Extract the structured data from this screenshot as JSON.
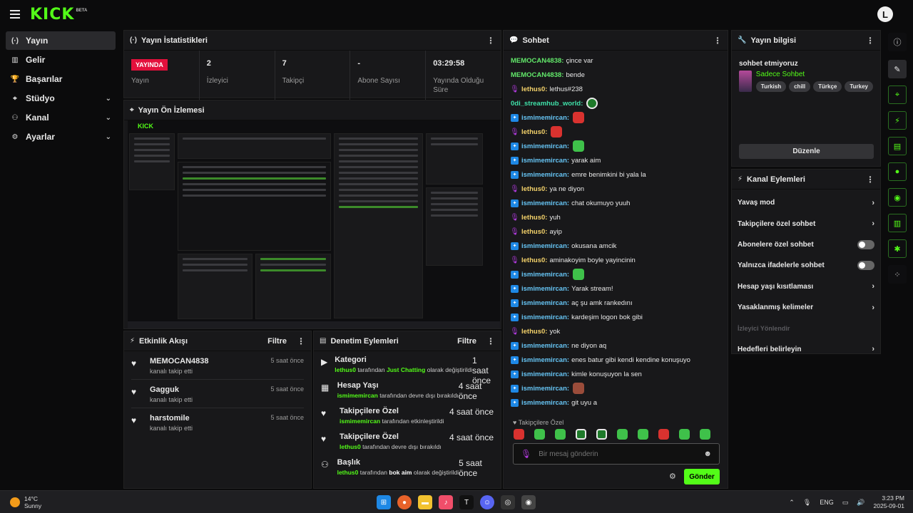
{
  "brand": {
    "logo": "KICK",
    "beta": "BETA",
    "avatar_letter": "L"
  },
  "sidebar": {
    "items": [
      {
        "label": "Yayın",
        "icon": "broadcast-icon",
        "glyph": "(·)"
      },
      {
        "label": "Gelir",
        "icon": "revenue-icon",
        "glyph": "▥"
      },
      {
        "label": "Başarılar",
        "icon": "trophy-icon",
        "glyph": "🏆"
      },
      {
        "label": "Stüdyo",
        "icon": "studio-icon",
        "glyph": "⌖"
      },
      {
        "label": "Kanal",
        "icon": "channel-icon",
        "glyph": "⚇"
      },
      {
        "label": "Ayarlar",
        "icon": "settings-icon",
        "glyph": "⚙"
      }
    ]
  },
  "stats_panel": {
    "title": "Yayın İstatistikleri",
    "live_label": "YAYINDA",
    "stats": [
      {
        "label": "Yayın"
      },
      {
        "value": "2",
        "label": "İzleyici"
      },
      {
        "value": "7",
        "label": "Takipçi"
      },
      {
        "value": "-",
        "label": "Abone Sayısı"
      },
      {
        "value": "03:29:58",
        "label": "Yayında Olduğu Süre"
      }
    ]
  },
  "preview_panel": {
    "title": "Yayın Ön İzlemesi",
    "mini_logo": "KICK"
  },
  "activity_panel": {
    "title": "Etkinlik Akışı",
    "filter": "Filtre",
    "items": [
      {
        "name": "MEMOCAN4838",
        "sub": "kanalı takip etti",
        "time": "5 saat önce"
      },
      {
        "name": "Gagguk",
        "sub": "kanalı takip etti",
        "time": "5 saat önce"
      },
      {
        "name": "harstomile",
        "sub": "kanalı takip etti",
        "time": "5 saat önce"
      }
    ]
  },
  "mod_panel": {
    "title": "Denetim Eylemleri",
    "filter": "Filtre",
    "items": [
      {
        "title": "Kategori",
        "time": "1 saat önce",
        "user": "lethus0",
        "mid": " tarafından ",
        "bold": "Just Chatting",
        "tail": " olarak değiştirildi"
      },
      {
        "title": "Hesap Yaşı",
        "time": "4 saat önce",
        "user": "ismimemircan",
        "mid": " tarafından devre dışı bırakıldı",
        "bold": "",
        "tail": ""
      },
      {
        "title": "Takipçilere Özel",
        "time": "4 saat önce",
        "user": "ismimemircan",
        "mid": " tarafından etkinleştirildi",
        "bold": "",
        "tail": ""
      },
      {
        "title": "Takipçilere Özel",
        "time": "4 saat önce",
        "user": "lethus0",
        "mid": " tarafından devre dışı bırakıldı",
        "bold": "",
        "tail": ""
      },
      {
        "title": "Başlık",
        "time": "5 saat önce",
        "user": "lethus0",
        "mid": " tarafından ",
        "bold": "bok aim",
        "tail": " olarak değiştirildi"
      }
    ]
  },
  "chat_panel": {
    "title": "Sohbet",
    "messages": [
      {
        "user": "MEMOCAN4838:",
        "text": "çince var",
        "badge": "none",
        "color": "green"
      },
      {
        "user": "MEMOCAN4838:",
        "text": "bende",
        "badge": "none",
        "color": "green"
      },
      {
        "user": "lethus0:",
        "text": "lethus#238",
        "badge": "mic",
        "color": "yellow"
      },
      {
        "user": "0di_streamhub_world:",
        "text": "",
        "badge": "none",
        "color": "cyan",
        "emote": "em-mix"
      },
      {
        "user": "ismimemircan:",
        "text": "",
        "badge": "blue",
        "color": "blue",
        "emote": "em-red"
      },
      {
        "user": "lethus0:",
        "text": "",
        "badge": "mic",
        "color": "yellow",
        "emote": "em-red"
      },
      {
        "user": "ismimemircan:",
        "text": "",
        "badge": "blue",
        "color": "blue",
        "emote": "em-green"
      },
      {
        "user": "ismimemircan:",
        "text": "yarak aim",
        "badge": "blue",
        "color": "blue"
      },
      {
        "user": "ismimemircan:",
        "text": "emre benimkini bi yala la",
        "badge": "blue",
        "color": "blue"
      },
      {
        "user": "lethus0:",
        "text": "ya ne diyon",
        "badge": "mic",
        "color": "yellow"
      },
      {
        "user": "ismimemircan:",
        "text": "chat okumuyo yuuh",
        "badge": "blue",
        "color": "blue"
      },
      {
        "user": "lethus0:",
        "text": "yuh",
        "badge": "mic",
        "color": "yellow"
      },
      {
        "user": "lethus0:",
        "text": "ayip",
        "badge": "mic",
        "color": "yellow"
      },
      {
        "user": "ismimemircan:",
        "text": "okusana amcik",
        "badge": "blue",
        "color": "blue"
      },
      {
        "user": "lethus0:",
        "text": "aminakoyim boyle yayincinin",
        "badge": "mic",
        "color": "yellow"
      },
      {
        "user": "ismimemircan:",
        "text": "",
        "badge": "blue",
        "color": "blue",
        "emote": "em-green"
      },
      {
        "user": "ismimemircan:",
        "text": "Yarak stream!",
        "badge": "blue",
        "color": "blue"
      },
      {
        "user": "ismimemircan:",
        "text": "aç şu amk rankedını",
        "badge": "blue",
        "color": "blue"
      },
      {
        "user": "ismimemircan:",
        "text": "kardeşim logon bok gibi",
        "badge": "blue",
        "color": "blue"
      },
      {
        "user": "lethus0:",
        "text": "yok",
        "badge": "mic",
        "color": "yellow"
      },
      {
        "user": "ismimemircan:",
        "text": "ne diyon aq",
        "badge": "blue",
        "color": "blue"
      },
      {
        "user": "ismimemircan:",
        "text": "enes batur gibi kendi kendine konuşuyo",
        "badge": "blue",
        "color": "blue"
      },
      {
        "user": "ismimemircan:",
        "text": "kimle konuşuyon la sen",
        "badge": "blue",
        "color": "blue"
      },
      {
        "user": "ismimemircan:",
        "text": "",
        "badge": "blue",
        "color": "blue",
        "emote": "em-brown"
      },
      {
        "user": "ismimemircan:",
        "text": "git uyu a",
        "badge": "blue",
        "color": "blue"
      }
    ],
    "sub_only_label": "Takipçilere Özel",
    "input_placeholder": "Bir mesaj gönderin",
    "send_label": "Gönder"
  },
  "stream_info_panel": {
    "title": "Yayın bilgisi",
    "stream_title": "sohbet etmiyoruz",
    "category": "Sadece Sohbet",
    "tags": [
      "Turkish",
      "chill",
      "Türkçe",
      "Turkey"
    ],
    "edit_label": "Düzenle"
  },
  "channel_actions_panel": {
    "title": "Kanal Eylemleri",
    "items": [
      {
        "label": "Yavaş mod",
        "kind": "chevron"
      },
      {
        "label": "Takipçilere özel sohbet",
        "kind": "chevron"
      },
      {
        "label": "Abonelere özel sohbet",
        "kind": "toggle"
      },
      {
        "label": "Yalnızca ifadelerle sohbet",
        "kind": "toggle"
      },
      {
        "label": "Hesap yaşı kısıtlaması",
        "kind": "chevron"
      },
      {
        "label": "Yasaklanmış kelimeler",
        "kind": "chevron"
      },
      {
        "label": "İzleyici Yönlendir",
        "kind": "disabled"
      },
      {
        "label": "Hedefleri belirleyin",
        "kind": "chevron"
      }
    ]
  },
  "taskbar": {
    "temperature": "14°C",
    "condition": "Sunny",
    "lang": "ENG",
    "time": "3:23 PM",
    "date": "2025-09-01"
  },
  "colors": {
    "accent": "#53fc18",
    "live": "#e3103c",
    "panel": "#18181a"
  }
}
